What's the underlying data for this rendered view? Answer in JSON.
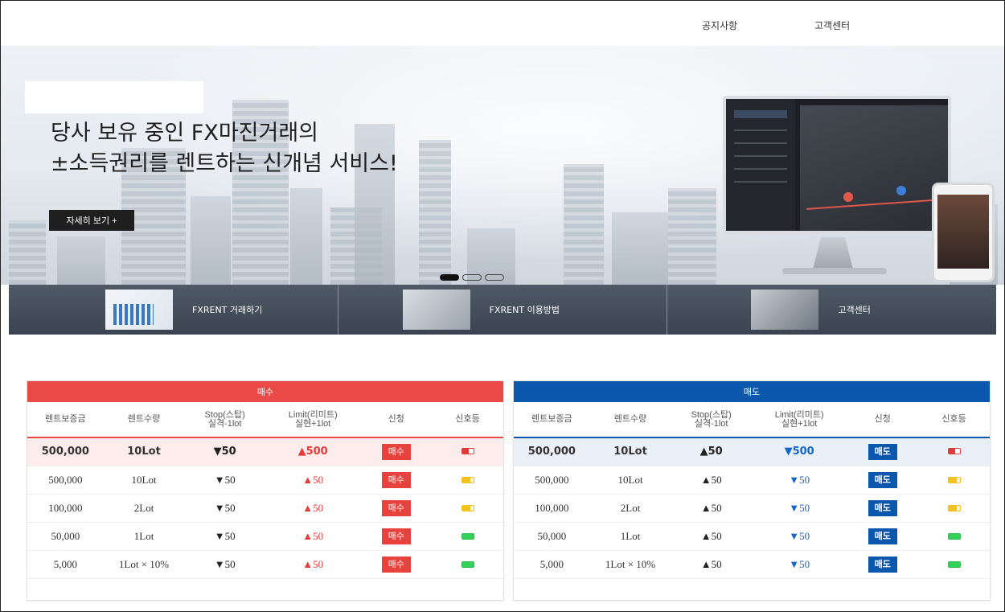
{
  "nav": {
    "notice": "공지사항",
    "support": "고객센터"
  },
  "hero": {
    "headline_line1": "당사 보유 중인 FX마진거래의",
    "headline_line2": "±소득권리를 렌트하는 신개념 서비스!",
    "more_button": "자세히 보기 +",
    "slide_count": 3,
    "active_slide": 1
  },
  "services": [
    {
      "label": "FXRENT 거래하기",
      "icon": "chart-report-photo"
    },
    {
      "label": "FXRENT 이용방법",
      "icon": "meeting-photo"
    },
    {
      "label": "고객센터",
      "icon": "office-photo"
    }
  ],
  "buy_panel": {
    "title": "매수",
    "color": "#ea4a47",
    "headers": [
      "렌트보증금",
      "렌트수량",
      "Stop(스탑)\n실격-1lot",
      "Limit(리미트)\n실현+1lot",
      "신청",
      "신호등"
    ],
    "rows": [
      {
        "deposit": "500,000",
        "qty": "10Lot",
        "stop": "▼50",
        "limit": "▲500",
        "action": "매수",
        "signal": "red"
      },
      {
        "deposit": "500,000",
        "qty": "10Lot",
        "stop": "▼50",
        "limit": "▲50",
        "action": "매수",
        "signal": "yellow"
      },
      {
        "deposit": "100,000",
        "qty": "2Lot",
        "stop": "▼50",
        "limit": "▲50",
        "action": "매수",
        "signal": "yellow"
      },
      {
        "deposit": "50,000",
        "qty": "1Lot",
        "stop": "▼50",
        "limit": "▲50",
        "action": "매수",
        "signal": "green"
      },
      {
        "deposit": "5,000",
        "qty": "1Lot × 10%",
        "stop": "▼50",
        "limit": "▲50",
        "action": "매수",
        "signal": "green"
      }
    ]
  },
  "sell_panel": {
    "title": "매도",
    "color": "#0b57ae",
    "headers": [
      "렌트보증금",
      "렌트수량",
      "Stop(스탑)\n실격-1lot",
      "Limit(리미트)\n실현+1lot",
      "신청",
      "신호등"
    ],
    "rows": [
      {
        "deposit": "500,000",
        "qty": "10Lot",
        "stop": "▲50",
        "limit": "▼500",
        "action": "매도",
        "signal": "red"
      },
      {
        "deposit": "500,000",
        "qty": "10Lot",
        "stop": "▲50",
        "limit": "▼50",
        "action": "매도",
        "signal": "yellow"
      },
      {
        "deposit": "100,000",
        "qty": "2Lot",
        "stop": "▲50",
        "limit": "▼50",
        "action": "매도",
        "signal": "yellow"
      },
      {
        "deposit": "50,000",
        "qty": "1Lot",
        "stop": "▲50",
        "limit": "▼50",
        "action": "매도",
        "signal": "green"
      },
      {
        "deposit": "5,000",
        "qty": "1Lot × 10%",
        "stop": "▲50",
        "limit": "▼50",
        "action": "매도",
        "signal": "green"
      }
    ]
  }
}
